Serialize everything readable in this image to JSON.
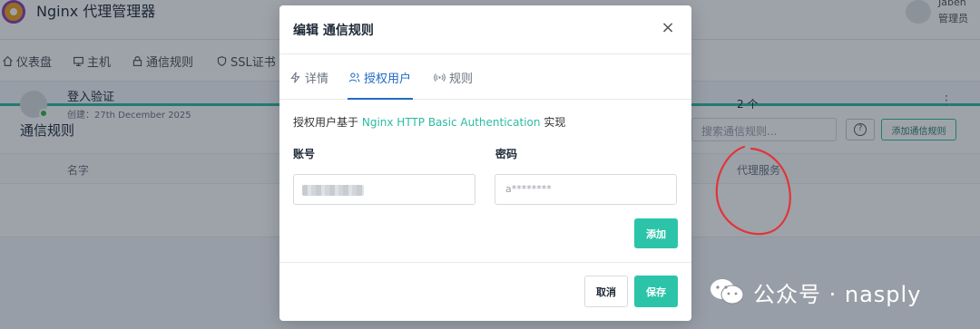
{
  "app": {
    "title": "Nginx 代理管理器",
    "user_name": "Jaben",
    "user_role": "管理员"
  },
  "nav": {
    "items": [
      {
        "label": "仪表盘",
        "icon": "home-icon"
      },
      {
        "label": "主机",
        "icon": "monitor-icon"
      },
      {
        "label": "通信规则",
        "icon": "lock-icon"
      },
      {
        "label": "SSL证书",
        "icon": "shield-icon"
      }
    ]
  },
  "card": {
    "title": "通信规则",
    "search_placeholder": "搜索通信规则...",
    "help_label": "?",
    "add_button": "添加通信规则",
    "columns": {
      "name": "名字",
      "services": "代理服务"
    },
    "rows": [
      {
        "name": "登入验证",
        "created": "创建：27th December 2025",
        "services_count": "2 个",
        "menu": "⋮"
      }
    ]
  },
  "modal": {
    "title": "编辑 通信规则",
    "close_label": "×",
    "tabs": [
      {
        "label": "详情",
        "icon": "bolt-icon",
        "active": false
      },
      {
        "label": "授权用户",
        "icon": "users-icon",
        "active": true
      },
      {
        "label": "规则",
        "icon": "signal-icon",
        "active": false
      }
    ],
    "intro_prefix": "授权用户基于",
    "intro_link": "Nginx HTTP Basic Authentication",
    "intro_suffix": "实现",
    "username_label": "账号",
    "password_label": "密码",
    "password_value": "a********",
    "add_button": "添加",
    "cancel_button": "取消",
    "save_button": "保存"
  },
  "watermark": {
    "text": "公众号 · nasply"
  },
  "colors": {
    "accent": "#2bc4a9",
    "link": "#206bc4",
    "overlay": "#182433",
    "annotation": "#e0353b"
  }
}
